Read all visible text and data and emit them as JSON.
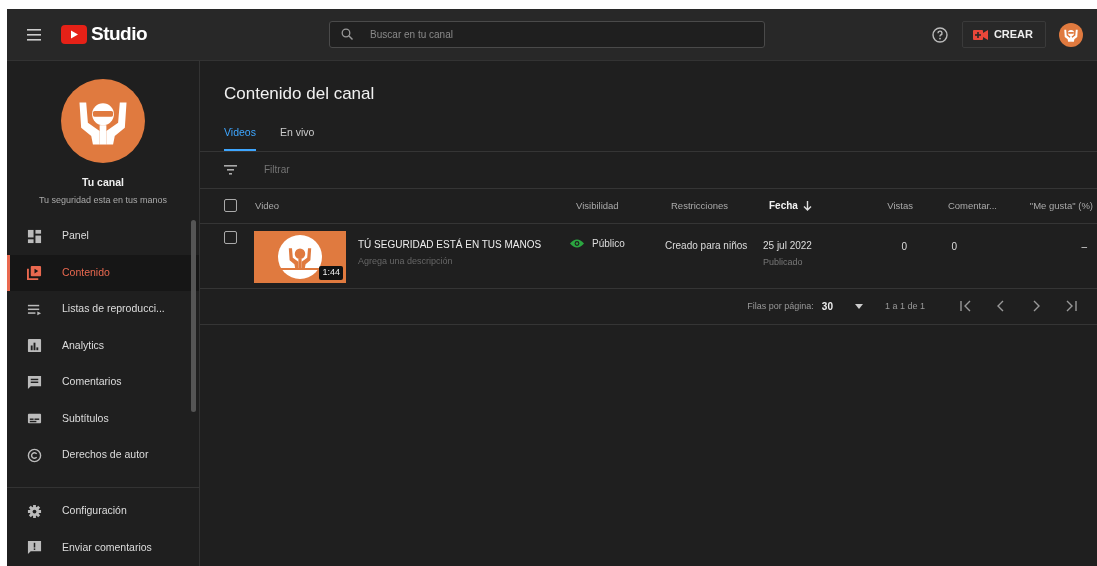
{
  "header": {
    "logo_text": "Studio",
    "search_placeholder": "Buscar en tu canal",
    "create_label": "CREAR"
  },
  "channel": {
    "name": "Tu canal",
    "tagline": "Tu seguridad esta en tus manos"
  },
  "nav": [
    {
      "label": "Panel",
      "kind": "dashboard",
      "selected": false
    },
    {
      "label": "Contenido",
      "kind": "content",
      "selected": true
    },
    {
      "label": "Listas de reproducci...",
      "kind": "playlist",
      "selected": false
    },
    {
      "label": "Analytics",
      "kind": "analytics",
      "selected": false
    },
    {
      "label": "Comentarios",
      "kind": "comments",
      "selected": false
    },
    {
      "label": "Subtítulos",
      "kind": "subtitles",
      "selected": false
    },
    {
      "label": "Derechos de autor",
      "kind": "copyright",
      "selected": false
    }
  ],
  "footer_nav": [
    {
      "label": "Configuración",
      "kind": "settings"
    },
    {
      "label": "Enviar comentarios",
      "kind": "feedback"
    }
  ],
  "page_title": "Contenido del canal",
  "tabs": [
    {
      "label": "Videos",
      "selected": true
    },
    {
      "label": "En vivo",
      "selected": false
    }
  ],
  "filter": {
    "placeholder": "Filtrar"
  },
  "table": {
    "select_all": {
      "checked": false
    },
    "columns": [
      {
        "label": "Video",
        "sorted": false
      },
      {
        "label": "Visibilidad",
        "sorted": false
      },
      {
        "label": "Restricciones",
        "sorted": false
      },
      {
        "label": "Fecha",
        "sorted": true
      },
      {
        "label": "Vistas",
        "sorted": false
      },
      {
        "label": "Comentar...",
        "sorted": false
      },
      {
        "label": "\"Me gusta\" (%)",
        "sorted": false
      }
    ],
    "rows": [
      {
        "selected": false,
        "title": "TÚ SEGURIDAD ESTÁ EN TUS MANOS",
        "description": "Agrega una descripción",
        "duration": "1:44",
        "visibility": "Público",
        "restriction": "Creado para niños",
        "date": "25 jul 2022",
        "date_status": "Publicado",
        "views": "0",
        "comments": "0",
        "likes": "–"
      }
    ]
  },
  "pagination": {
    "rows_label": "Filas por página:",
    "rows_value": "30",
    "range": "1 a 1 de 1"
  }
}
